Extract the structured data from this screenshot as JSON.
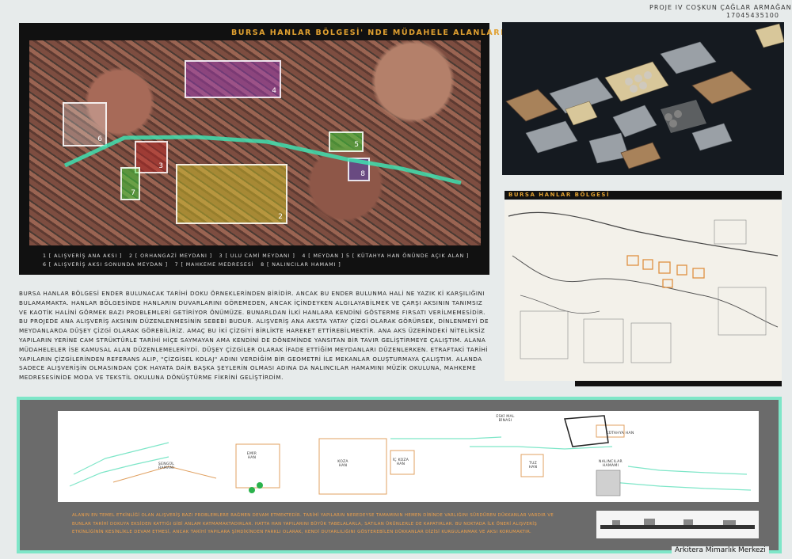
{
  "header": {
    "project": "PROJE IV  COŞKUN ÇAĞLAR ARMAĞAN",
    "student_no": "17045435100"
  },
  "panel1": {
    "title": "BURSA HANLAR BÖLGESİ' NDE MÜDAHELE ALANLARI",
    "zone_numbers": [
      "1",
      "2",
      "3",
      "4",
      "5",
      "6",
      "7",
      "8"
    ],
    "legend_line1": "1 [ ALIŞVERİŞ ANA AKSI ]   2 [ ORHANGAZİ MEYDANI ]   3 [ ULU CAMİ MEYDANI ]   4 [ MEYDAN ] 5 [ KÜTAHYA HAN ÖNÜNDE AÇIK ALAN ]",
    "legend_line2": "6 [ ALIŞVERİŞ AKSI SONUNDA MEYDAN ]   7 [ MAHKEME MEDRESESİ   8 [ NALINCILAR HAMAMI ]"
  },
  "panel3": {
    "title": "BURSA HANLAR BÖLGESİ"
  },
  "paragraph": "BURSA HANLAR BÖLGESİ ENDER BULUNACAK TARİHİ DOKU ÖRNEKLERİNDEN BİRİDİR. ANCAK BU ENDER BULUNMA HALİ NE YAZIK Kİ KARŞILIĞINI BULAMAMAKTA. HANLAR BÖLGESİNDE HANLARIN DUVARLARINI GÖREMEDEN, ANCAK İÇİNDEYKEN ALGILAYABİLMEK VE ÇARŞI AKSININ TANIMSIZ VE KAOTİK HALİNİ GÖRMEK BAZI PROBLEMLERİ GETİRİYOR ÖNÜMÜZE. BUNARLDAN İLKİ HANLARA KENDİNİ GÖSTERME FIRSATI VERİLMEMESİDİR. BU PROJEDE ANA ALIŞVERİŞ AKSININ DÜZENLENMESİNİN SEBEBİ BUDUR. ALIŞVERİŞ ANA AKSTA YATAY ÇİZGİ OLARAK GÖRÜRSEK, DİNLENMEYİ DE MEYDANLARDA DÜŞEY ÇİZGİ OLARAK GÖREBİLİRİZ. AMAÇ BU İKİ ÇİZGİYİ BİRLİKTE HAREKET ETTİREBİLMEKTİR. ANA AKS ÜZERİNDEKİ NİTELİKSİZ YAPILARIN YERİNE CAM STRÜKTÜRLE TARİHİ HİÇE SAYMAYAN AMA KENDİNİ DE DÖNEMİNDE YANSITAN BİR TAVIR GELİŞTİRMEYE ÇALIŞTIM. ALANA MÜDAHELELER İSE KAMUSAL ALAN DÜZENLEMELERİYDİ. DÜŞEY ÇİZGİLER OLARAK İFADE ETTİĞİM MEYDANLARI DÜZENLERKEN. ETRAFTAKİ TARİHİ YAPILARIN ÇİZGİLERİNDEN REFERANS ALIP, \"ÇİZGİSEL KOLAJ\" ADINI VERDİĞİM BİR GEOMETRİ İLE MEKANLAR OLUŞTURMAYA ÇALIŞTIM. ALANDA SADECE ALIŞVERİŞİN OLMASINDAN ÇOK HAYATA DAİR BAŞKA ŞEYLERİN OLMASI ADINA DA NALINCILAR HAMAMINI MÜZİK OKULUNA, MAHKEME MEDRESESİNİDE MODA VE TEKSTİL OKULUNA DÖNÜŞTÜRME FİKRİNİ GELİŞTİRDİM.",
  "plan_labels": {
    "eski_mal": "ESKİ MAL BİNASI",
    "kutahya": "KÜTAHYA HAN",
    "emir": "EMİR HAN",
    "koza": "KOZA HAN",
    "ic_koza": "İÇ KOZA HAN",
    "tuz": "TUZ HAN",
    "sengul": "ŞENGÜL HAMAMI",
    "nalincilar": "NALINCILAR HAMAMI"
  },
  "bottom_text": "ALANIN EN TEMEL ETKİNLİĞİ OLAN ALIŞVERİŞ BAZI PROBLEMLERE RAĞMEN DEVAM ETMEKTEDİR. TARİHİ YAPILARIN NEREDEYSE TAMAMININ HEMEN DİBİNDE VARLIĞINI SÜRDÜREN DÜKKANLAR VARDIR VE BUNLAR TARİHİ DOKUYA EKSİDEN KATTIĞI GİBİ ANLAM KATMAMAKTADIRLAR. HATTA HAN YAPILARINI BÜYÜK TABELALARLA, SATILAN ÜRÜNLERLE DE KAPATIRLAR. BU NOKTADA İLK ÖNERİ ALIŞVERİŞ ETKİNLİĞİNİN KESİNLİKLE DEVAM ETMESİ, ANCAK TARİHİ YAPILARA ŞİMDİKİNDEN FARKLI OLARAK, KENDİ DUYARLILIĞINI GÖSTEREBİLEN DÜKKANLAR DİZİSİ KURGULANMAK VE AKSI KORUMAKTIR.",
  "credit": "Arkitera Mimarlık Merkezi",
  "colors": {
    "accent_orange": "#e0a030",
    "frame_teal": "#7ee6c8",
    "axis": "#3fe0b0"
  }
}
